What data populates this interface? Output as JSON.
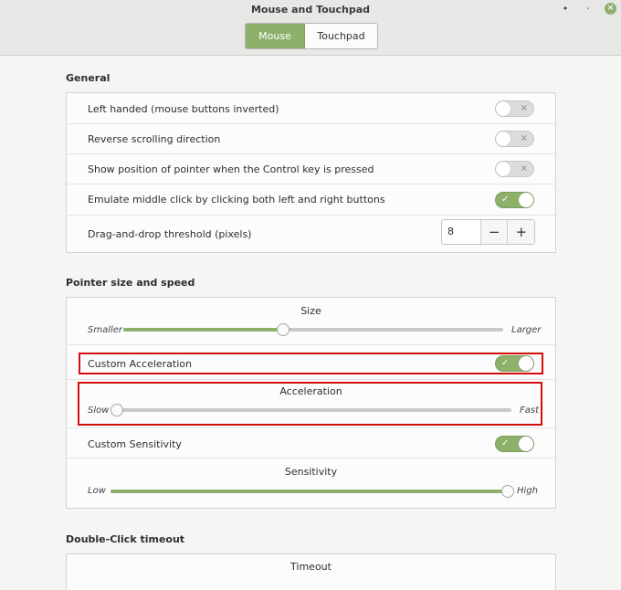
{
  "window": {
    "title": "Mouse and Touchpad",
    "minimize": "•",
    "restore": "⋅",
    "close": "×"
  },
  "tabs": [
    {
      "label": "Mouse",
      "active": true
    },
    {
      "label": "Touchpad",
      "active": false
    }
  ],
  "general": {
    "title": "General",
    "rows": [
      {
        "label": "Left handed (mouse buttons inverted)",
        "on": false
      },
      {
        "label": "Reverse scrolling direction",
        "on": false
      },
      {
        "label": "Show position of pointer when the Control key is pressed",
        "on": false
      },
      {
        "label": "Emulate middle click by clicking both left and right buttons",
        "on": true
      }
    ],
    "threshold": {
      "label": "Drag-and-drop threshold (pixels)",
      "value": "8",
      "minus": "−",
      "plus": "+"
    }
  },
  "pointer": {
    "title": "Pointer size and speed",
    "size": {
      "title": "Size",
      "min_label": "Smaller",
      "max_label": "Larger",
      "value": 0.42
    },
    "custom_acceleration": {
      "label": "Custom Acceleration",
      "on": true
    },
    "acceleration": {
      "title": "Acceleration",
      "min_label": "Slow",
      "max_label": "Fast",
      "value": 0.0
    },
    "custom_sensitivity": {
      "label": "Custom Sensitivity",
      "on": true
    },
    "sensitivity": {
      "title": "Sensitivity",
      "min_label": "Low",
      "max_label": "High",
      "value": 1.0
    }
  },
  "double_click": {
    "title": "Double-Click timeout",
    "timeout_title": "Timeout"
  },
  "toggle_marks": {
    "on": "✓",
    "off": "×"
  },
  "colors": {
    "accent": "#8db06a",
    "highlight": "#d40d0d"
  }
}
